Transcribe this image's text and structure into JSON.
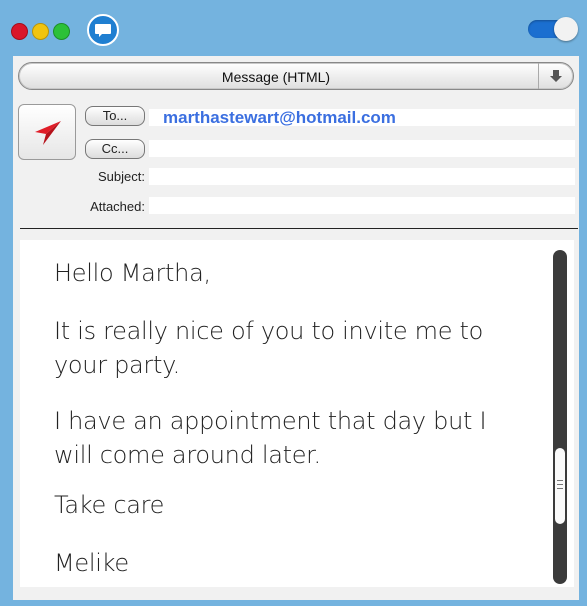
{
  "window": {
    "icons": {
      "close": "red-light",
      "minimize": "yellow-light",
      "zoom": "green-light",
      "chat": "speech-bubble-icon",
      "toggle": "toggle-switch"
    },
    "colors": {
      "frame": "#74b3df",
      "accent": "#3b6fe0"
    }
  },
  "header": {
    "format_label": "Message (HTML)",
    "to_label": "To...",
    "cc_label": "Cc...",
    "subject_label": "Subject:",
    "attached_label": "Attached:",
    "to_value": "marthastewart@hotmail.com",
    "cc_value": "",
    "subject_value": "",
    "attached_value": ""
  },
  "message": {
    "paragraphs": [
      "Hello Martha,",
      "It is really nice of you to invite me to your party.",
      "I have an appointment that day but I will come around later.",
      "Take care",
      "Melike"
    ]
  }
}
